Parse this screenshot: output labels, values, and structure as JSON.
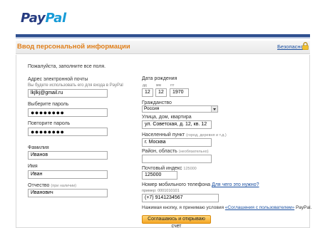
{
  "logo": {
    "part1": "Pay",
    "part2": "Pal"
  },
  "header": {
    "title": "Ввод персональной информации",
    "secure_link": "Безопасно"
  },
  "intro": "Пожалуйста, заполните все поля.",
  "left": {
    "email": {
      "label": "Адрес электронной почты",
      "hint": "Вы будете использовать его для входа в PayPal",
      "value": "lkjlkj@gmail.ru"
    },
    "password": {
      "label": "Выберите пароль",
      "value": "●●●●●●●●"
    },
    "password_repeat": {
      "label": "Повторите пароль",
      "value": "●●●●●●●●"
    },
    "last_name": {
      "label": "Фамилия",
      "value": "Иванов"
    },
    "first_name": {
      "label": "Имя",
      "value": "Иван"
    },
    "middle_name": {
      "label": "Отчество",
      "hint": "(при наличии)",
      "value": "Иванович"
    }
  },
  "right": {
    "birth": {
      "label": "Дата рождения",
      "day_label": "дд",
      "month_label": "мм",
      "year_label": "ггг",
      "day": "12",
      "month": "12",
      "year": "1970"
    },
    "citizenship": {
      "label": "Гражданство",
      "value": "Россия"
    },
    "street": {
      "label": "Улица, дом, квартира",
      "value": "ул. Советская, д. 12, кв. 12"
    },
    "city": {
      "label": "Населенный пункт",
      "hint": "(город, деревня и т.д.)",
      "value": "г. Москва"
    },
    "region": {
      "label": "Район, область",
      "hint": "(необязательно)",
      "value": ""
    },
    "postal": {
      "label": "Почтовый индекс",
      "hint": "125000",
      "value": "125000"
    },
    "phone": {
      "label": "Номер мобильного телефона",
      "link": "Для чего это нужно?",
      "example": "пример: 0001010101",
      "value": "(+7) 9141234567"
    },
    "agreement": {
      "text_before": "Нажимая кнопку, я принимаю условия",
      "link": "«Соглашения с пользователем»",
      "text_after": "PayPal."
    },
    "submit": "Соглашаюсь и открываю счет"
  }
}
